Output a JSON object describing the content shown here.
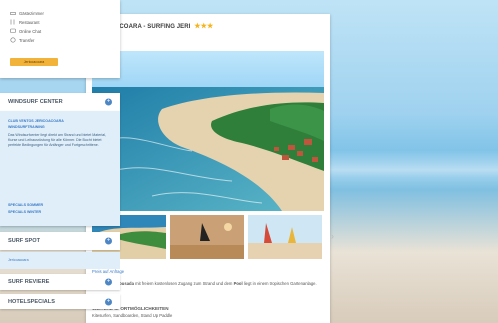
{
  "left_panel": {
    "title": "JERICOACOARA - SURFING JERI",
    "stars": "★★★",
    "photo_link": "Preis auf Anfrage",
    "description_prefix": "Die",
    "description_bold": "beliebte Pousada",
    "description_mid": "mit freiem kostenlosen Zugang zum Strand und dem",
    "description_bold2": "Pool",
    "description_suffix": "liegt in einem tropischen Gartenanlage.",
    "section_heading": "WEITERE SPORTMÖGLICHKEITEN",
    "section_text": "Kitesurfen, Sandboarden, Stand Up Paddle"
  },
  "right_panel": {
    "links": [
      "Gästezimmer",
      "Restaurant",
      "Online Chat",
      "Transfer"
    ],
    "tag_button": "Jericoacoara",
    "windsurf_center": {
      "heading": "WINDSURF CENTER",
      "link1": "CLUB VENTOS JERICOACOARA",
      "link2": "WINDSURFTRAINING",
      "body": "Das Windsurfcenter liegt direkt am Strand und bietet Material, Kurse und Leihausrüstung für alle Könner. Die Bucht bietet perfekte Bedingungen für Anfänger und Fortgeschrittene.",
      "link3": "SPECIALS SOMMER",
      "link4": "SPECIALS WINTER"
    },
    "surf_spot": {
      "heading": "SURF SPOT",
      "link": "Jericoacoara"
    },
    "surf_reviere": {
      "heading": "SURF REVIERE"
    },
    "hotelspecials": {
      "heading": "HOTELSPECIALS"
    }
  }
}
